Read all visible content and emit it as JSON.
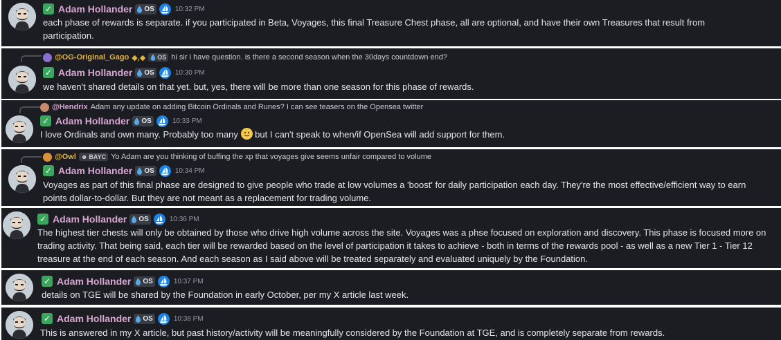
{
  "user": {
    "name": "Adam Hollander",
    "os_tag": "OS"
  },
  "messages": [
    {
      "time": "10:32 PM",
      "text": "each phase of rewards is separate. if you participated in Beta, Voyages, this final Treasure Chest phase, all are optional, and have their own Treasures that result from participation."
    },
    {
      "reply_to": {
        "name": "@OG-Original_Gago",
        "suffix": "◆,◆",
        "tag": "OS",
        "text": "hi sir i have question. is there a second season when the 30days countdown end?"
      },
      "time": "10:30 PM",
      "text": "we haven't shared details on that yet.  but, yes, there will be more than one season for this phase of rewards."
    },
    {
      "reply_to": {
        "name": "@Hendrix",
        "text": "Adam any update on adding Bitcoin Ordinals and Runes? I can see teasers on the Opensea twitter"
      },
      "time": "10:33 PM",
      "text_before": "I love Ordinals and own many. Probably too many",
      "text_after": " but I can't speak to when/if OpenSea will add support for them."
    },
    {
      "reply_to": {
        "name": "@Owl",
        "tag": "BAYC",
        "text": "Yo Adam are you thinking of buffing the xp that voyages give seems unfair compared to volume"
      },
      "time": "10:34 PM",
      "text": "Voyages as part of this final phase are designed to give people who trade at low volumes a 'boost' for daily participation each day. They're the most effective/efficient way to earn points dollar-to-dollar. But they are not meant as a replacement for trading volume."
    },
    {
      "time": "10:36 PM",
      "text": "The highest tier chests will only be obtained by those who drive high volume across the site. Voyages was a phse focused on exploration and discovery. This phase is focused more on trading activity. That being said, each tier will be rewarded based on the level of participation it takes to achieve - both in terms of the rewards pool - as well as a new Tier 1 - Tier 12 treasure at the end of each season. And each season as I said above will be treated separately and evaluated uniquely by the Foundation."
    },
    {
      "time": "10:37 PM",
      "text": "details on TGE will be shared by the Foundation in early October, per my X article last week."
    },
    {
      "time": "10:38 PM",
      "text": "This is answered in my X article, but past history/activity will be meaningfully considered by the Foundation at TGE, and is completely separate from rewards."
    }
  ],
  "colors": {
    "background": "#1c1d22",
    "username": "#d9a6d3",
    "check": "#3ba55d",
    "opensea_blue": "#2081e2",
    "reply_gago": "#e3b341",
    "reply_hendrix": "#d8a8d8",
    "reply_owl": "#e3b341"
  },
  "icons": {
    "verified": "check-mark-icon",
    "badge": "opensea-logo-icon",
    "tag": "water-drop-icon",
    "emoji": "slightly-smiling-face-emoji"
  }
}
